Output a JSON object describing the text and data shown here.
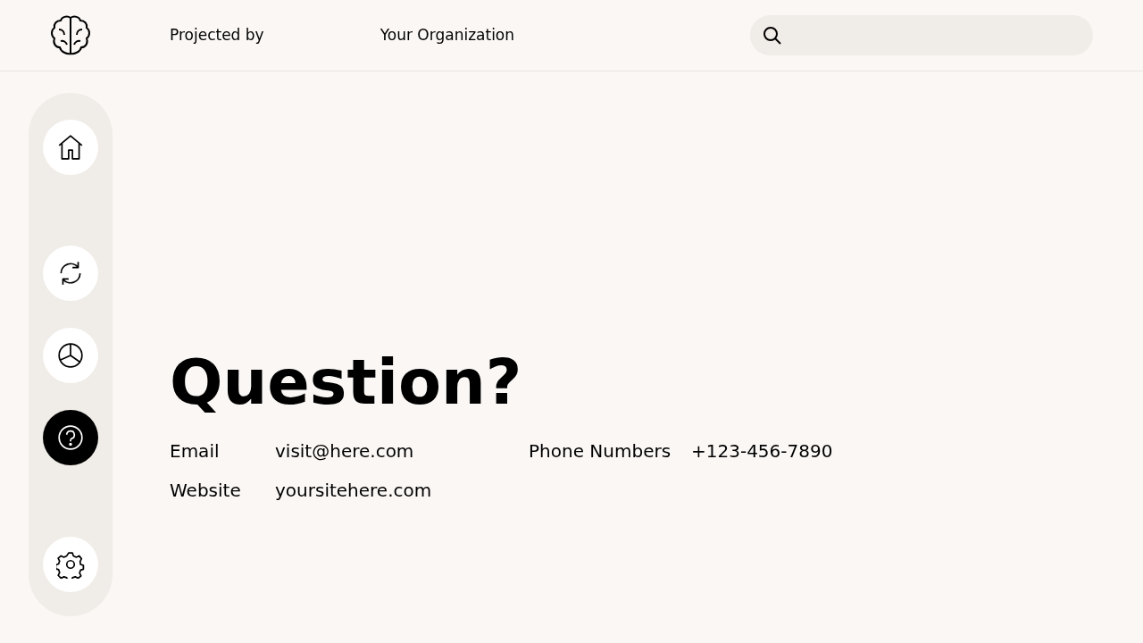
{
  "header": {
    "projected_label": "Projected by",
    "organization": "Your Organization"
  },
  "sidebar": {
    "items": [
      {
        "kind": "home",
        "selected": false
      },
      {
        "kind": "refresh",
        "selected": false
      },
      {
        "kind": "chart",
        "selected": false
      },
      {
        "kind": "help",
        "selected": true
      },
      {
        "kind": "settings",
        "selected": false
      }
    ]
  },
  "title": "Question?",
  "contacts": [
    {
      "label": "Email",
      "value": "visit@here.com"
    },
    {
      "label": "Phone Numbers",
      "value": "+123-456-7890"
    },
    {
      "label": "Website",
      "value": "yoursitehere.com"
    }
  ]
}
